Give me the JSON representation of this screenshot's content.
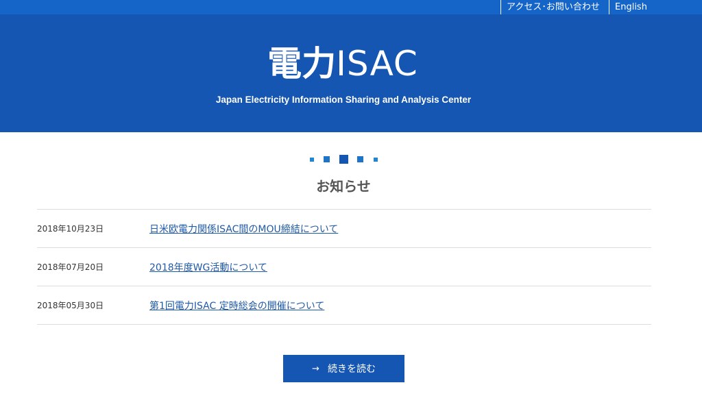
{
  "topbar": {
    "access_contact": "アクセス･お問い合わせ",
    "english": "English"
  },
  "hero": {
    "logo_kanji": "電力",
    "logo_latin": "ISAC",
    "tagline": "Japan Electricity Information Sharing and Analysis Center"
  },
  "news": {
    "title": "お知らせ",
    "items": [
      {
        "date": "2018年10月23日",
        "title": "日米欧電力関係ISAC間のMOU締結について"
      },
      {
        "date": "2018年07月20日",
        "title": "2018年度WG活動について"
      },
      {
        "date": "2018年05月30日",
        "title": "第1回電力ISAC 定時総会の開催について"
      }
    ],
    "more_label": "続きを読む",
    "more_icon": "arrow-right-icon"
  },
  "colors": {
    "topbar": "#1565c9",
    "hero": "#1556b2",
    "link": "#1e5aa8",
    "accent_dot": "#1e74c8"
  }
}
